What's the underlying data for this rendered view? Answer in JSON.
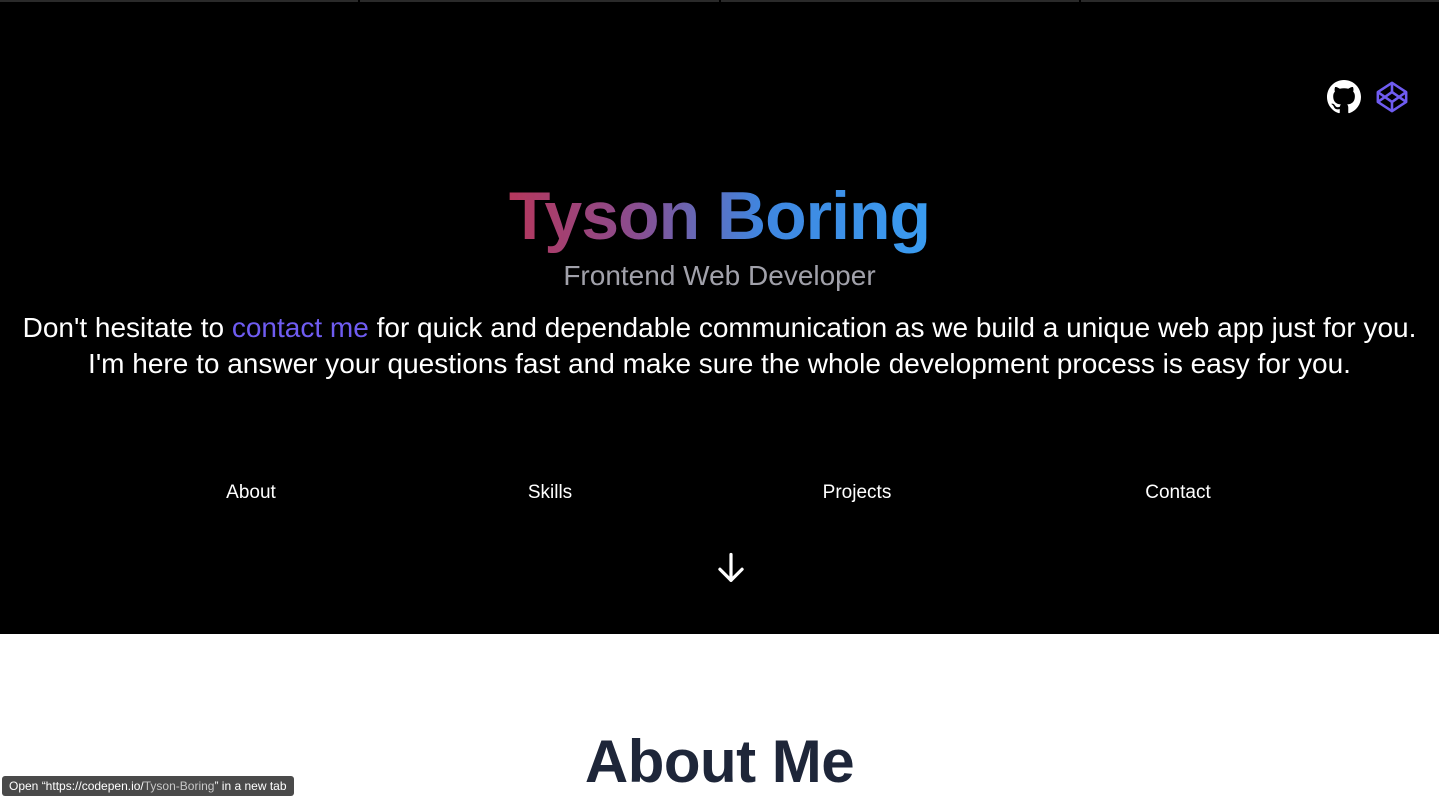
{
  "hero": {
    "name": "Tyson Boring",
    "subtitle": "Frontend Web Developer",
    "intro_before": "Don't hesitate to ",
    "intro_link": "contact me",
    "intro_after": " for quick and dependable communication as we build a unique web app just for you. I'm here to answer your questions fast and make sure the whole development process is easy for you."
  },
  "social": {
    "items": [
      {
        "icon": "github-icon",
        "color": "#ffffff"
      },
      {
        "icon": "codepen-icon",
        "color": "#6f5cf1"
      }
    ]
  },
  "nav": {
    "items": [
      {
        "label": "About"
      },
      {
        "label": "Skills"
      },
      {
        "label": "Projects"
      },
      {
        "label": "Contact"
      }
    ]
  },
  "scroll": {
    "icon": "arrow-down-icon"
  },
  "about": {
    "title": "About Me"
  },
  "status_bar": {
    "prefix": "Open “https://codepen.io/",
    "path": "Tyson-Boring",
    "suffix": "” in a new tab"
  },
  "colors": {
    "hero_bg": "#000000",
    "accent": "#6f5cf1",
    "subtitle": "#a1a1aa",
    "heading_dark": "#1e2639",
    "name_gradient_start": "#b5375c",
    "name_gradient_end": "#3a9cf0"
  }
}
